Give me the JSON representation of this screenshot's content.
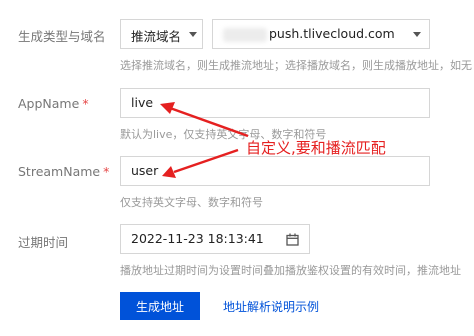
{
  "form": {
    "type_domain": {
      "label": "生成类型与域名",
      "type_select_value": "推流域名",
      "domain_select_value": "push.tlivecloud.com",
      "hint": "选择推流域名，则生成推流地址；选择播放域名，则生成播放地址，如无"
    },
    "app_name": {
      "label": "AppName",
      "value": "live",
      "hint": "默认为live，仅支持英文字母、数字和符号"
    },
    "stream_name": {
      "label": "StreamName",
      "value": "user",
      "hint": "仅支持英文字母、数字和符号"
    },
    "expire_time": {
      "label": "过期时间",
      "value": "2022-11-23 18:13:41",
      "hint": "播放地址过期时间为设置时间叠加播放鉴权设置的有效时间，推流地址"
    },
    "required_mark": "*",
    "generate_button": "生成地址",
    "help_link": "地址解析说明示例"
  },
  "annotation": {
    "text": "自定义,要和播流匹配",
    "color": "#e52020"
  },
  "colors": {
    "primary": "#0052d9",
    "required": "#e54545",
    "annotation": "#e52020"
  },
  "icons": [
    "chevron-down-icon",
    "calendar-icon",
    "arrow-annotation-icon"
  ]
}
